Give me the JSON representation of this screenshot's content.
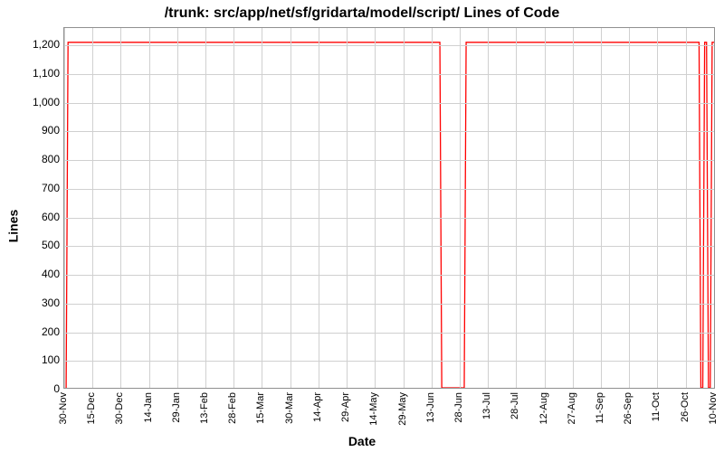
{
  "chart_data": {
    "type": "line",
    "title": "/trunk: src/app/net/sf/gridarta/model/script/ Lines of Code",
    "xlabel": "Date",
    "ylabel": "Lines",
    "ylim": [
      0,
      1260
    ],
    "y_ticks": [
      0,
      100,
      200,
      300,
      400,
      500,
      600,
      700,
      800,
      900,
      1000,
      1100,
      1200
    ],
    "x_ticks": [
      "30-Nov",
      "15-Dec",
      "30-Dec",
      "14-Jan",
      "29-Jan",
      "13-Feb",
      "28-Feb",
      "15-Mar",
      "30-Mar",
      "14-Apr",
      "29-Apr",
      "14-May",
      "29-May",
      "13-Jun",
      "28-Jun",
      "13-Jul",
      "28-Jul",
      "12-Aug",
      "27-Aug",
      "11-Sep",
      "26-Sep",
      "11-Oct",
      "26-Oct",
      "10-Nov"
    ],
    "x_domain_days": 346,
    "series": [
      {
        "name": "Lines of Code",
        "points": [
          {
            "x_day": 1,
            "y": 0
          },
          {
            "x_day": 2,
            "y": 1210
          },
          {
            "x_day": 200,
            "y": 1210
          },
          {
            "x_day": 201,
            "y": 0
          },
          {
            "x_day": 213,
            "y": 0
          },
          {
            "x_day": 214,
            "y": 1210
          },
          {
            "x_day": 338,
            "y": 1210
          },
          {
            "x_day": 339,
            "y": 0
          },
          {
            "x_day": 340,
            "y": 0
          },
          {
            "x_day": 341,
            "y": 1210
          },
          {
            "x_day": 342,
            "y": 1210
          },
          {
            "x_day": 343,
            "y": 0
          },
          {
            "x_day": 344,
            "y": 0
          },
          {
            "x_day": 345,
            "y": 1210
          },
          {
            "x_day": 346,
            "y": 1210
          }
        ]
      }
    ]
  }
}
